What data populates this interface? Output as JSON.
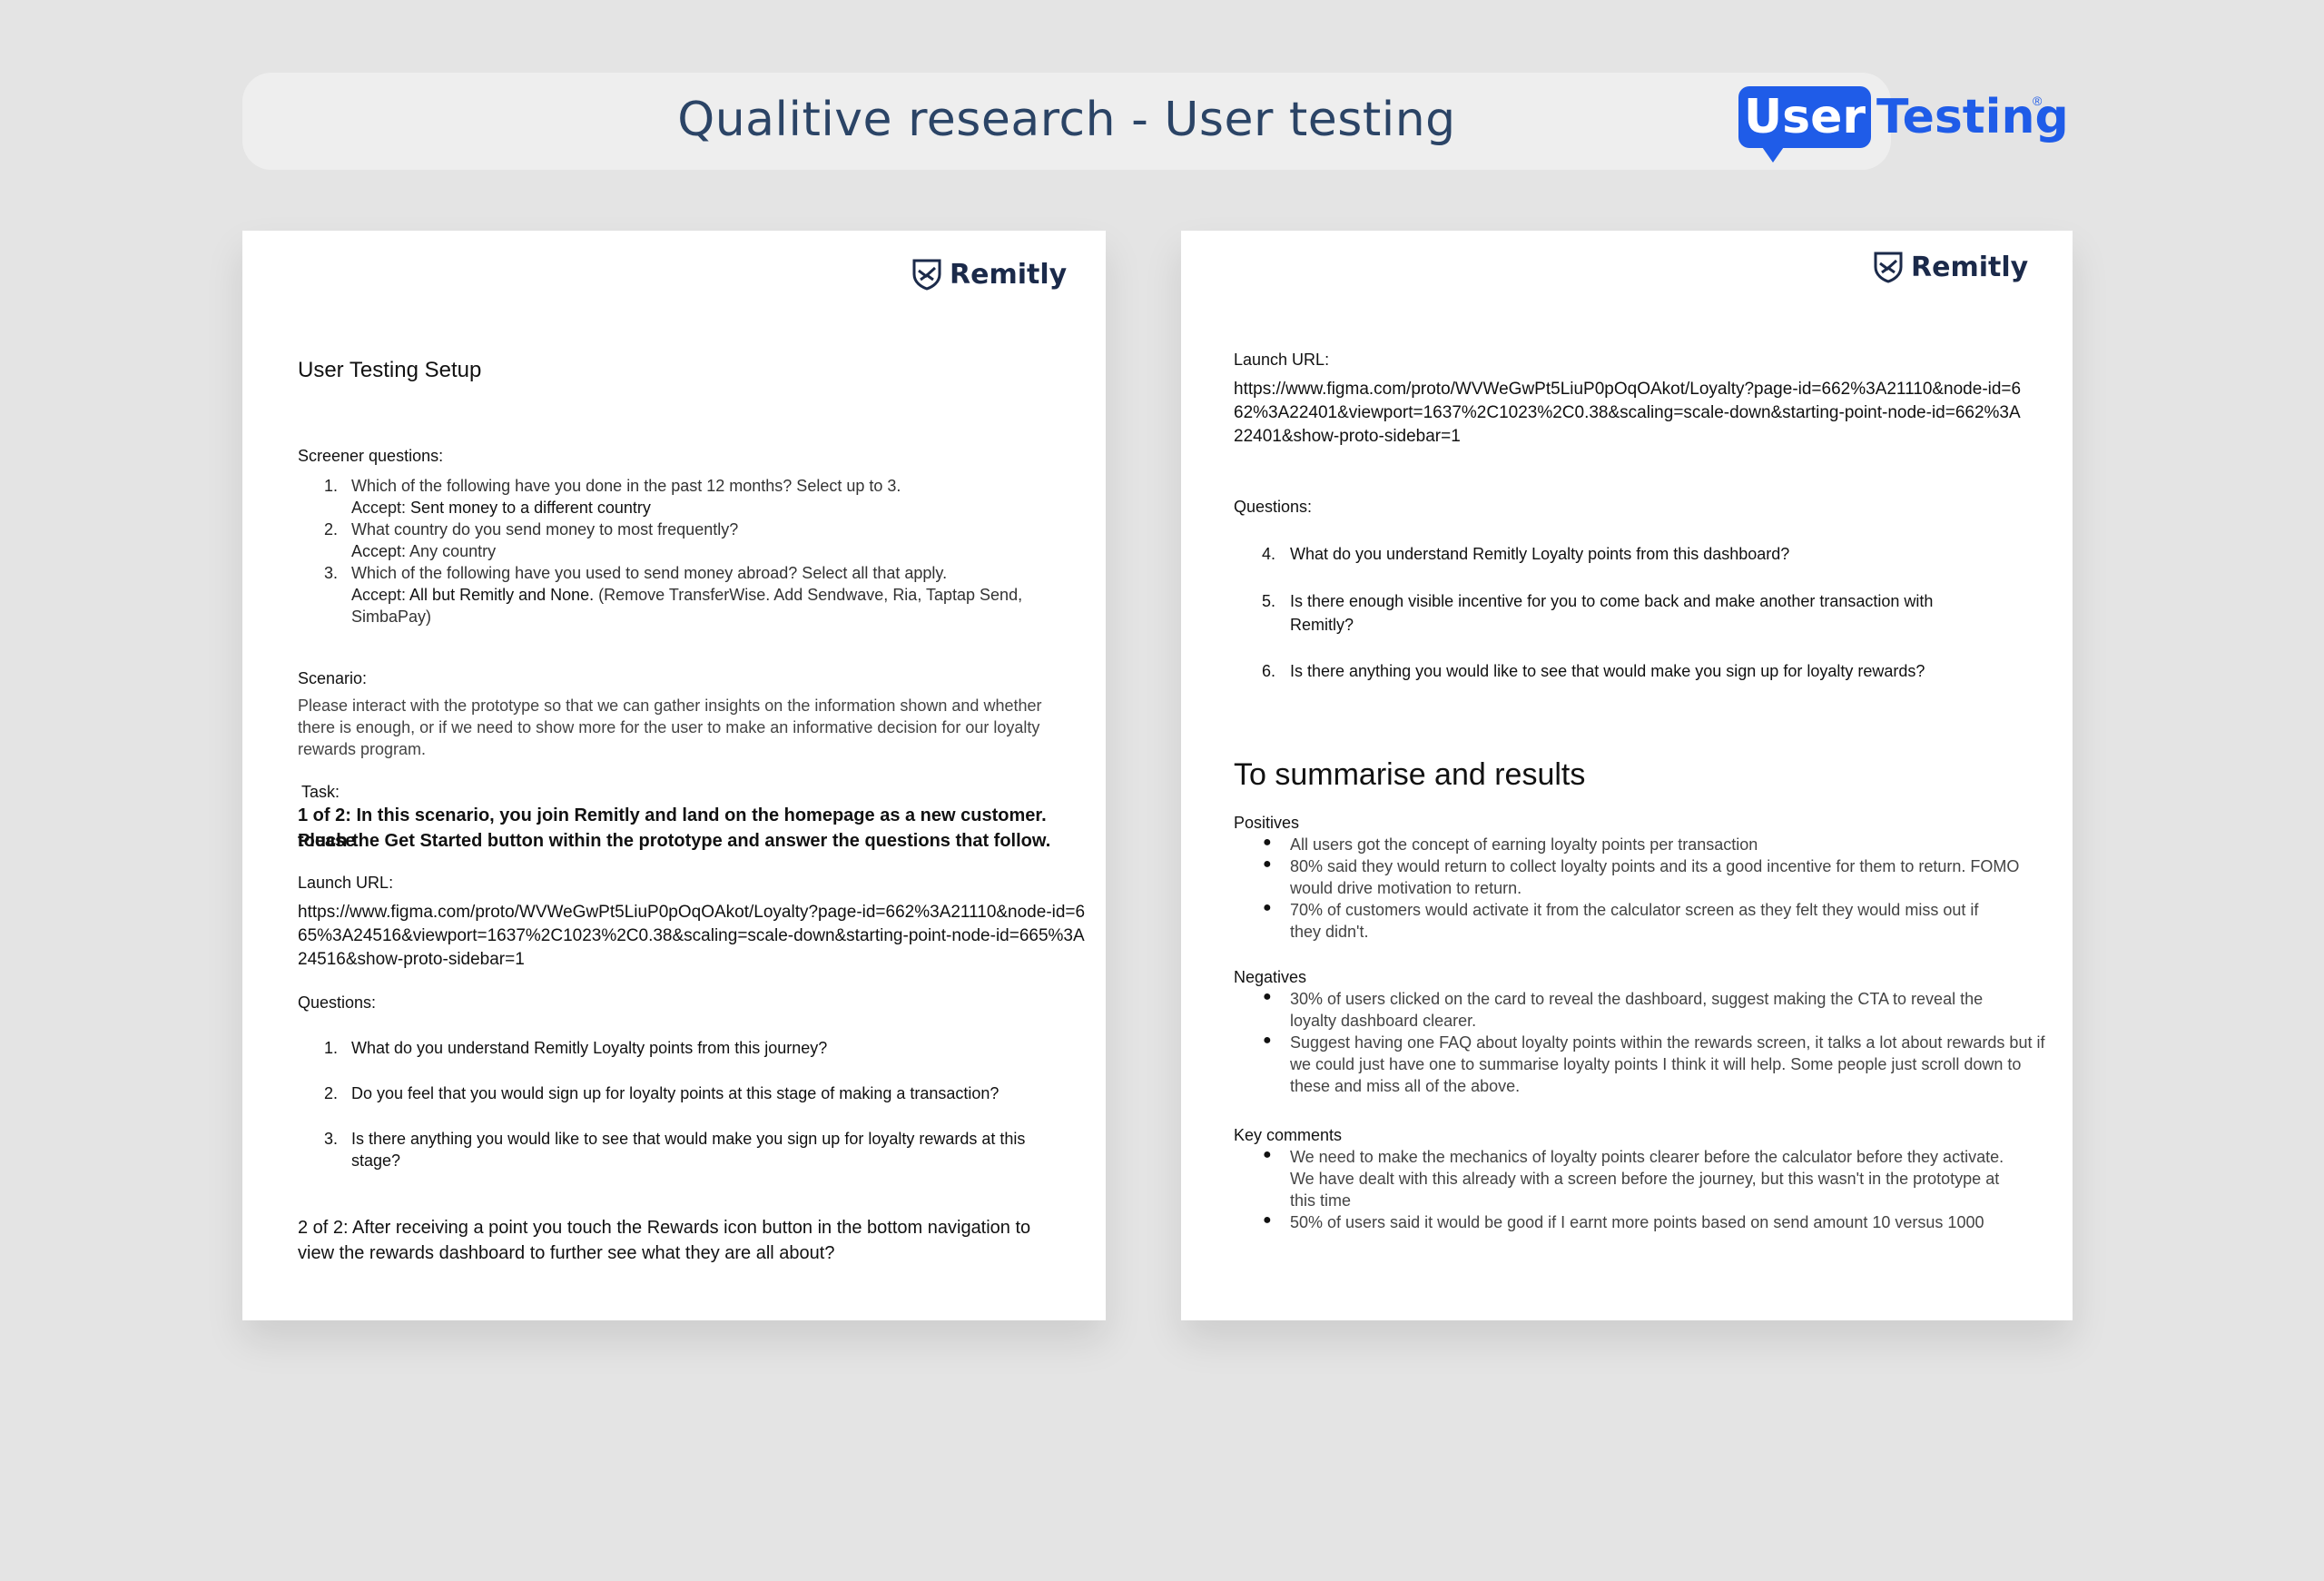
{
  "header": {
    "title": "Qualitive research - User testing",
    "logo": {
      "box_text": "User",
      "text": "Testing",
      "reg": "®",
      "color": "#1f5ce8"
    }
  },
  "brand": {
    "name": "Remitly",
    "icon": "remitly-shield-icon",
    "color": "#1b2a4a"
  },
  "left_doc": {
    "title": "User Testing Setup",
    "screener_label": "Screener questions:",
    "screener": [
      {
        "num": "1.",
        "q": "Which of the following have you done in the past 12 months? Select up to 3.",
        "accept_label": "Accept:",
        "accept": "Sent money to a different country",
        "note": ""
      },
      {
        "num": "2.",
        "q": "What country do you send money to most frequently?",
        "accept_label": "Accept:",
        "accept": "Any country",
        "note": ""
      },
      {
        "num": "3.",
        "q": "Which of the following have you used to send money abroad? Select all that apply.",
        "accept_label": "Accept:",
        "accept": "All but Remitly and None.",
        "note": "(Remove TransferWise. Add Sendwave, Ria, Taptap Send,",
        "note2": "SimbaPay)"
      }
    ],
    "scenario_label": "Scenario:",
    "scenario_lines": [
      "Please interact with the prototype so that we can gather insights on the information shown and whether",
      "there is enough, or if we need to show more for the user to make an informative decision for our loyalty",
      "rewards program."
    ],
    "task_label": "Task:",
    "task1_lines": [
      "1 of 2: In this scenario, you join Remitly and land on the homepage as a new customer. Please",
      "touch the Get Started button within the prototype and answer the questions that follow."
    ],
    "launch_label": "Launch URL:",
    "url_lines": [
      "https://www.figma.com/proto/WVWeGwPt5LiuP0pOqOAkot/Loyalty?page-id=662%3A21110&node-id=6",
      "65%3A24516&viewport=1637%2C1023%2C0.38&scaling=scale-down&starting-point-node-id=665%3A",
      "24516&show-proto-sidebar=1"
    ],
    "questions_label": "Questions:",
    "questions": [
      {
        "num": "1.",
        "lines": [
          "What do you understand Remitly Loyalty points from this journey?"
        ]
      },
      {
        "num": "2.",
        "lines": [
          "Do you feel that you would sign up for loyalty points at this stage of making a transaction?"
        ]
      },
      {
        "num": "3.",
        "lines": [
          "Is there anything you would like to see that would make you sign up for loyalty rewards at this",
          "stage?"
        ]
      }
    ],
    "task2_lines": [
      "2 of 2: After receiving a point you touch the Rewards icon button in the bottom navigation to",
      "view the rewards dashboard to further see what they are all about?"
    ]
  },
  "right_doc": {
    "launch_label": "Launch URL:",
    "url_lines": [
      "https://www.figma.com/proto/WVWeGwPt5LiuP0pOqOAkot/Loyalty?page-id=662%3A21110&node-id=6",
      "62%3A22401&viewport=1637%2C1023%2C0.38&scaling=scale-down&starting-point-node-id=662%3A",
      "22401&show-proto-sidebar=1"
    ],
    "questions_label": "Questions:",
    "questions": [
      {
        "num": "4.",
        "lines": [
          "What do you understand Remitly Loyalty points from this dashboard?"
        ]
      },
      {
        "num": "5.",
        "lines": [
          "Is there enough visible incentive for you to come back and make another transaction with",
          "Remitly?"
        ]
      },
      {
        "num": "6.",
        "lines": [
          "Is there anything you would like to see that would make you sign up for loyalty rewards?"
        ]
      }
    ],
    "summary_title": "To summarise and results",
    "positives_label": "Positives",
    "positives": [
      [
        "All users got the concept of earning loyalty points per transaction"
      ],
      [
        "80% said they would return to collect loyalty points and its a good incentive for them to return. FOMO",
        "would drive motivation to return."
      ],
      [
        "70% of customers would activate it from the calculator screen as they felt they would miss out if",
        "they didn't."
      ]
    ],
    "negatives_label": "Negatives",
    "negatives": [
      [
        "30% of users clicked on the card to reveal the dashboard, suggest making the CTA to reveal the",
        "loyalty dashboard clearer."
      ],
      [
        "Suggest having one FAQ about loyalty points within the rewards screen, it talks a lot about rewards but if",
        "we could just have one to summarise loyalty points I think it will help. Some people just scroll down to",
        "these and miss all of the above."
      ]
    ],
    "key_label": "Key comments",
    "key_comments": [
      [
        "We need to make the mechanics of loyalty points clearer before the calculator before they activate.",
        "We have dealt with this already with a screen before the journey, but this wasn't in the prototype at",
        "this time"
      ],
      [
        "50% of users said it would be good if I earnt more points based on send amount 10 versus 1000"
      ]
    ]
  }
}
